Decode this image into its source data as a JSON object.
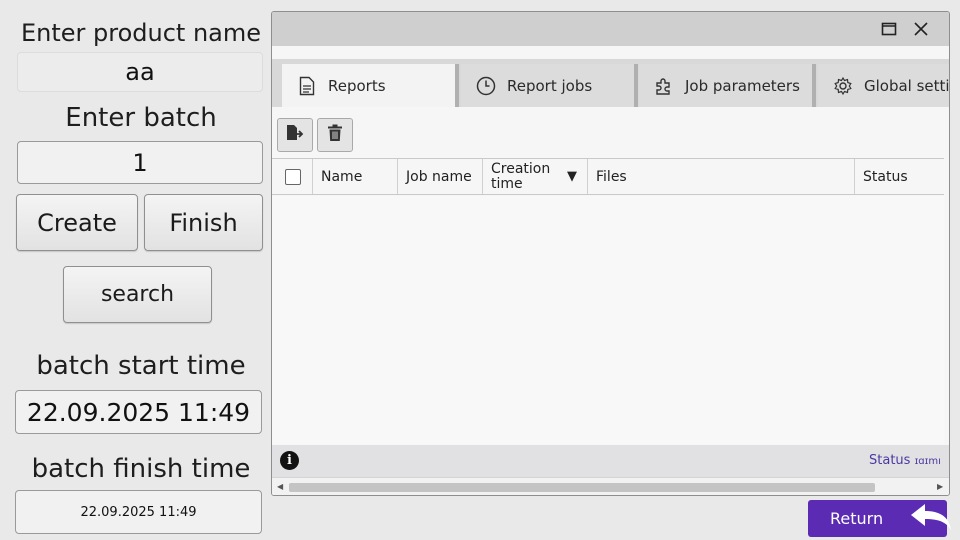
{
  "left_panel": {
    "product_label": "Enter product name",
    "product_value": "aa",
    "batch_label": "Enter batch",
    "batch_value": "1",
    "create_label": "Create",
    "finish_label": "Finish",
    "search_label": "search",
    "start_time_label": "batch start time",
    "start_time_value": "22.09.2025 11:49",
    "finish_time_label": "batch finish time",
    "finish_time_value": "22.09.2025 11:49"
  },
  "report_window": {
    "tabs": [
      {
        "label": "Reports",
        "icon": "document-icon",
        "active": true
      },
      {
        "label": "Report jobs",
        "icon": "clock-icon",
        "active": false
      },
      {
        "label": "Job parameters",
        "icon": "puzzle-icon",
        "active": false
      },
      {
        "label": "Global setti",
        "icon": "gear-icon",
        "active": false
      }
    ],
    "toolbar": [
      {
        "icon": "export-report-icon"
      },
      {
        "icon": "trash-icon"
      }
    ],
    "columns": [
      "Name",
      "Job name",
      "Creation time",
      "Files",
      "Status"
    ],
    "sort_indicator": "▼",
    "rows": [],
    "status_text": "Status",
    "status_suffix": "ɪɑɪmı"
  },
  "return_label": "Return",
  "colors": {
    "accent": "#5b2bb3",
    "status_text": "#4a3aa0",
    "background": "#e9e9e9"
  }
}
